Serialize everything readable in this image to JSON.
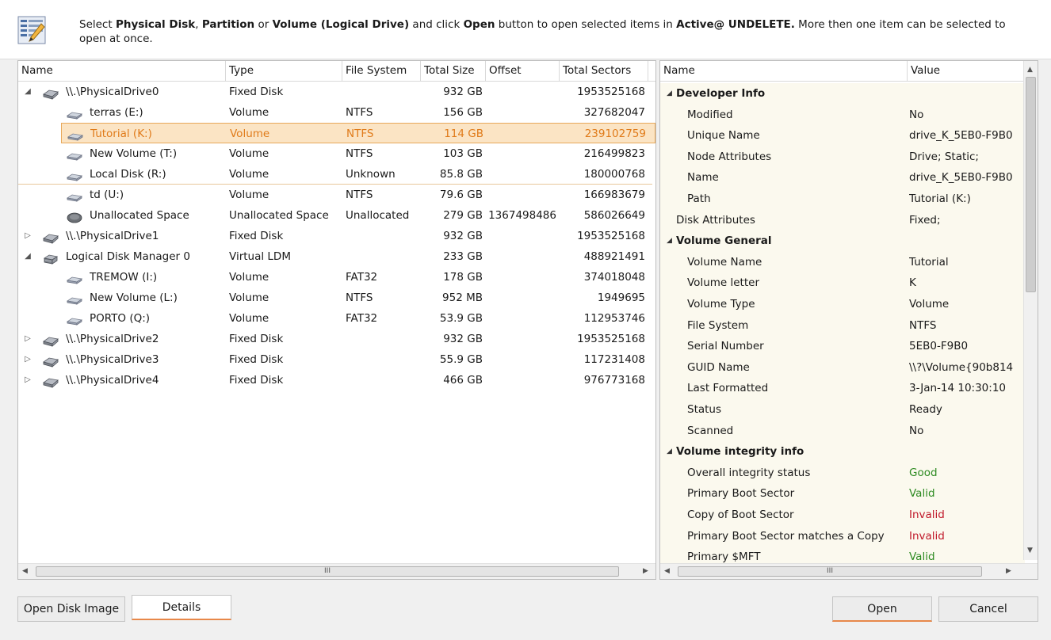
{
  "header": {
    "text_parts": [
      {
        "t": "Select ",
        "b": false
      },
      {
        "t": "Physical Disk",
        "b": true
      },
      {
        "t": ", ",
        "b": false
      },
      {
        "t": "Partition",
        "b": true
      },
      {
        "t": " or ",
        "b": false
      },
      {
        "t": "Volume (Logical Drive)",
        "b": true
      },
      {
        "t": " and click ",
        "b": false
      },
      {
        "t": "Open",
        "b": true
      },
      {
        "t": " button to open selected items in ",
        "b": false
      },
      {
        "t": "Active@ UNDELETE.",
        "b": true
      },
      {
        "t": " More then one item can be selected to open at once.",
        "b": false
      }
    ]
  },
  "disk_table": {
    "columns": [
      "Name",
      "Type",
      "File System",
      "Total Size",
      "Offset",
      "Total Sectors"
    ],
    "rows": [
      {
        "name": "\\\\.\\PhysicalDrive0",
        "type": "Fixed Disk",
        "fs": "",
        "size": "932 GB",
        "offset": "",
        "sectors": "1953525168",
        "level": 0,
        "expander": "open",
        "icon": "physical-disk-icon"
      },
      {
        "name": "terras (E:)",
        "type": "Volume",
        "fs": "NTFS",
        "size": "156 GB",
        "offset": "",
        "sectors": "327682047",
        "level": 1,
        "expander": "",
        "icon": "volume-icon"
      },
      {
        "name": "Tutorial (K:)",
        "type": "Volume",
        "fs": "NTFS",
        "size": "114 GB",
        "offset": "",
        "sectors": "239102759",
        "level": 1,
        "expander": "",
        "icon": "volume-icon",
        "selected": true
      },
      {
        "name": "New Volume (T:)",
        "type": "Volume",
        "fs": "NTFS",
        "size": "103 GB",
        "offset": "",
        "sectors": "216499823",
        "level": 1,
        "expander": "",
        "icon": "volume-icon"
      },
      {
        "name": "Local Disk (R:)",
        "type": "Volume",
        "fs": "Unknown",
        "size": "85.8 GB",
        "offset": "",
        "sectors": "180000768",
        "level": 1,
        "expander": "",
        "icon": "volume-icon",
        "highlight_bottom": true
      },
      {
        "name": "td (U:)",
        "type": "Volume",
        "fs": "NTFS",
        "size": "79.6 GB",
        "offset": "",
        "sectors": "166983679",
        "level": 1,
        "expander": "",
        "icon": "volume-icon"
      },
      {
        "name": "Unallocated Space",
        "type": "Unallocated Space",
        "fs": "Unallocated",
        "size": "279 GB",
        "offset": "1367498486",
        "sectors": "586026649",
        "level": 1,
        "expander": "",
        "icon": "unallocated-icon"
      },
      {
        "name": "\\\\.\\PhysicalDrive1",
        "type": "Fixed Disk",
        "fs": "",
        "size": "932 GB",
        "offset": "",
        "sectors": "1953525168",
        "level": 0,
        "expander": "closed",
        "icon": "physical-disk-icon"
      },
      {
        "name": "Logical Disk Manager 0",
        "type": "Virtual LDM",
        "fs": "",
        "size": "233 GB",
        "offset": "",
        "sectors": "488921491",
        "level": 0,
        "expander": "open",
        "icon": "ldm-icon"
      },
      {
        "name": "TREMOW (I:)",
        "type": "Volume",
        "fs": "FAT32",
        "size": "178 GB",
        "offset": "",
        "sectors": "374018048",
        "level": 1,
        "expander": "",
        "icon": "volume-icon"
      },
      {
        "name": "New Volume (L:)",
        "type": "Volume",
        "fs": "NTFS",
        "size": "952 MB",
        "offset": "",
        "sectors": "1949695",
        "level": 1,
        "expander": "",
        "icon": "volume-icon"
      },
      {
        "name": "PORTO (Q:)",
        "type": "Volume",
        "fs": "FAT32",
        "size": "53.9 GB",
        "offset": "",
        "sectors": "112953746",
        "level": 1,
        "expander": "",
        "icon": "volume-icon"
      },
      {
        "name": "\\\\.\\PhysicalDrive2",
        "type": "Fixed Disk",
        "fs": "",
        "size": "932 GB",
        "offset": "",
        "sectors": "1953525168",
        "level": 0,
        "expander": "closed",
        "icon": "physical-disk-icon"
      },
      {
        "name": "\\\\.\\PhysicalDrive3",
        "type": "Fixed Disk",
        "fs": "",
        "size": "55.9 GB",
        "offset": "",
        "sectors": "117231408",
        "level": 0,
        "expander": "closed",
        "icon": "physical-disk-icon"
      },
      {
        "name": "\\\\.\\PhysicalDrive4",
        "type": "Fixed Disk",
        "fs": "",
        "size": "466 GB",
        "offset": "",
        "sectors": "976773168",
        "level": 0,
        "expander": "closed",
        "icon": "physical-disk-icon"
      }
    ],
    "hscroll_thumb_label": "III"
  },
  "properties": {
    "columns": [
      "Name",
      "Value"
    ],
    "rows": [
      {
        "name": "Developer Info",
        "value": "",
        "kind": "group"
      },
      {
        "name": "Modified",
        "value": "No",
        "kind": "prop"
      },
      {
        "name": "Unique Name",
        "value": "drive_K_5EB0-F9B0",
        "kind": "prop"
      },
      {
        "name": "Node Attributes",
        "value": "Drive; Static;",
        "kind": "prop"
      },
      {
        "name": "Name",
        "value": "drive_K_5EB0-F9B0",
        "kind": "prop"
      },
      {
        "name": "Path",
        "value": "Tutorial (K:)",
        "kind": "prop"
      },
      {
        "name": "Disk Attributes",
        "value": "Fixed;",
        "kind": "top"
      },
      {
        "name": "Volume General",
        "value": "",
        "kind": "group"
      },
      {
        "name": "Volume Name",
        "value": "Tutorial",
        "kind": "prop"
      },
      {
        "name": "Volume letter",
        "value": "K",
        "kind": "prop"
      },
      {
        "name": "Volume Type",
        "value": "Volume",
        "kind": "prop"
      },
      {
        "name": "File System",
        "value": "NTFS",
        "kind": "prop"
      },
      {
        "name": "Serial Number",
        "value": "5EB0-F9B0",
        "kind": "prop"
      },
      {
        "name": "GUID Name",
        "value": "\\\\?\\Volume{90b814",
        "kind": "prop"
      },
      {
        "name": "Last Formatted",
        "value": "3-Jan-14 10:30:10",
        "kind": "prop"
      },
      {
        "name": "Status",
        "value": "Ready",
        "kind": "prop"
      },
      {
        "name": "Scanned",
        "value": "No",
        "kind": "prop"
      },
      {
        "name": "Volume integrity info",
        "value": "",
        "kind": "group"
      },
      {
        "name": "Overall integrity status",
        "value": "Good",
        "kind": "prop",
        "status": "good"
      },
      {
        "name": "Primary Boot Sector",
        "value": "Valid",
        "kind": "prop",
        "status": "good"
      },
      {
        "name": "Copy of Boot Sector",
        "value": "Invalid",
        "kind": "prop",
        "status": "bad"
      },
      {
        "name": "Primary Boot Sector matches a Copy",
        "value": "Invalid",
        "kind": "prop",
        "status": "bad"
      },
      {
        "name": "Primary $MFT",
        "value": "Valid",
        "kind": "prop",
        "status": "good"
      }
    ],
    "hscroll_thumb_label": "III"
  },
  "buttons": {
    "open_disk_image": "Open Disk Image",
    "details": "Details",
    "open": "Open",
    "cancel": "Cancel"
  },
  "colors": {
    "selected_bg": "#fbe4c4",
    "selected_text": "#e07b1a",
    "good": "#2e8b22",
    "bad": "#c0192a",
    "accent_underline": "#e8884a"
  }
}
